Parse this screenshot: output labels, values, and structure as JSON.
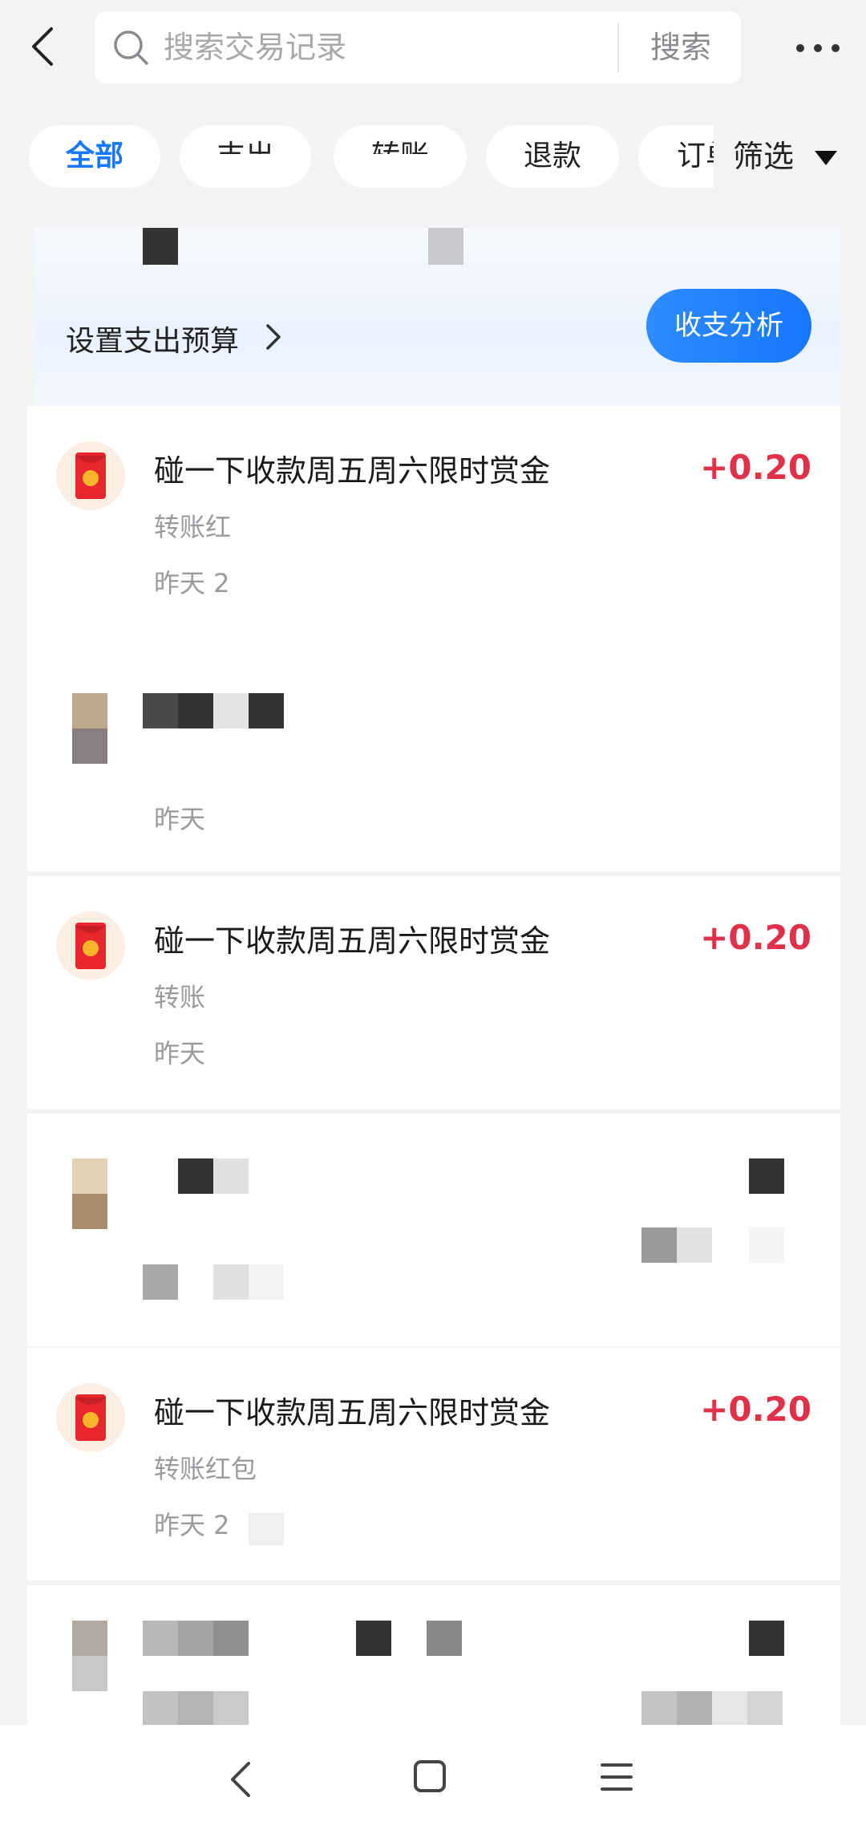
{
  "header": {
    "search_placeholder": "搜索交易记录",
    "search_button": "搜索",
    "back_icon": "chevron-left-icon",
    "more_icon": "more-dots-icon"
  },
  "filters": {
    "chips": [
      {
        "label": "全部",
        "active": true
      },
      {
        "label": "支出",
        "active": false
      },
      {
        "label": "转账",
        "active": false
      },
      {
        "label": "退款",
        "active": false
      },
      {
        "label": "订单",
        "active": false
      }
    ],
    "filter_label": "筛选"
  },
  "budget": {
    "label": "设置支出预算",
    "analysis_button": "收支分析"
  },
  "transactions": [
    {
      "title": "碰一下收款周五周六限时赏金",
      "amount": "+0.20",
      "subtitle": "转账红",
      "date": "昨天 2"
    },
    {
      "title": "",
      "amount": "",
      "subtitle": "",
      "date": "昨天"
    },
    {
      "title": "碰一下收款周五周六限时赏金",
      "amount": "+0.20",
      "subtitle": "转账",
      "date": "昨天"
    },
    {
      "title": "",
      "amount": "",
      "subtitle": "",
      "date": ""
    },
    {
      "title": "碰一下收款周五周六限时赏金",
      "amount": "+0.20",
      "subtitle": "转账红包",
      "date": "昨天 2"
    }
  ],
  "colors": {
    "accent": "#1677ff",
    "income": "#e0304a",
    "background": "#f2f3f5"
  }
}
